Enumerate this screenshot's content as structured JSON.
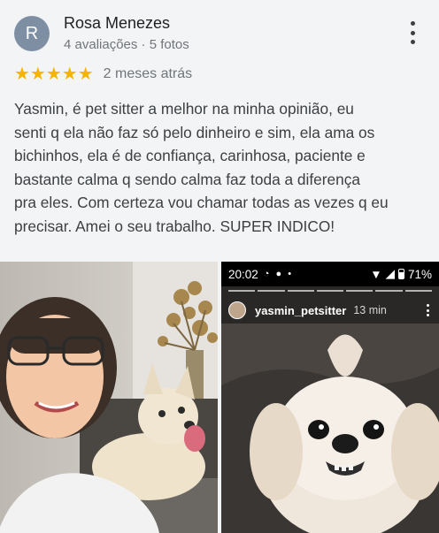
{
  "reviewer": {
    "avatar_initial": "R",
    "name": "Rosa Menezes",
    "meta": "4 avaliações · 5 fotos"
  },
  "rating": {
    "stars_text": "★★★★★",
    "value": 5,
    "max": 5,
    "time_ago": "2 meses atrás",
    "star_color": "#f4b400"
  },
  "review_lines": [
    "Yasmin, é pet sitter a melhor na minha opinião, eu",
    "senti q ela não faz só pelo dinheiro e sim, ela ama os",
    "bichinhos, ela é de confiança, carinhosa, paciente e",
    "bastante calma q sendo calma faz toda a diferença",
    "pra eles. Com certeza vou chamar todas as vezes q eu",
    "precisar. Amei o seu trabalho. SUPER INDICO!"
  ],
  "story": {
    "time": "20:02",
    "battery": "71%",
    "username": "yasmin_petsitter",
    "posted": "13 min"
  },
  "icons": {
    "menu": "more-vert-icon",
    "whatsapp": "whatsapp-icon",
    "wifi": "wifi-icon",
    "signal": "signal-icon",
    "battery": "battery-icon"
  }
}
